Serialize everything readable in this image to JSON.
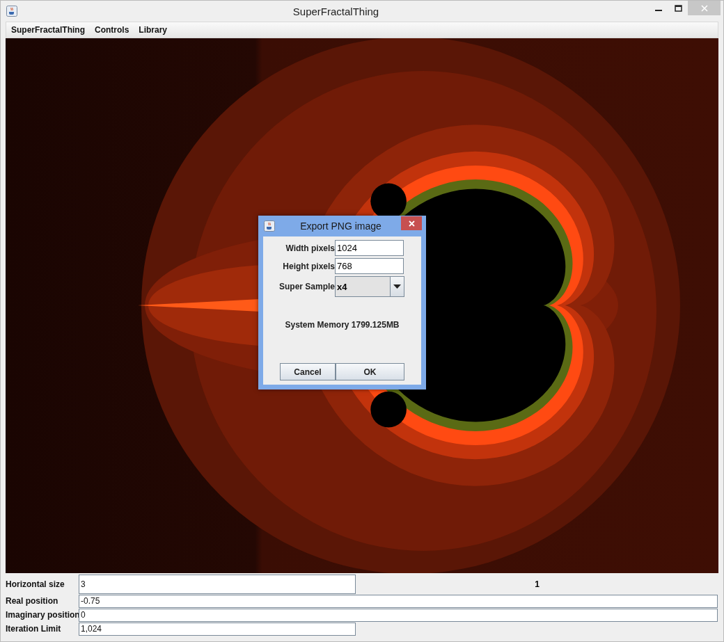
{
  "window": {
    "title": "SuperFractalThing"
  },
  "menu": [
    "SuperFractalThing",
    "Controls",
    "Library"
  ],
  "dialog": {
    "title": "Export PNG image",
    "fields": [
      {
        "label": "Width pixels",
        "value": "1024",
        "kind": "text"
      },
      {
        "label": "Height pixels",
        "value": "768",
        "kind": "text"
      },
      {
        "label": "Super Sample",
        "value": "x4",
        "kind": "dropdown"
      }
    ],
    "memory": "System Memory 1799.125MB",
    "buttons": [
      "Cancel",
      "OK"
    ]
  },
  "controls": [
    {
      "label": "Horizontal size",
      "value": "3",
      "kind": "short",
      "note": "1"
    },
    {
      "label": "Real position",
      "value": "-0.75",
      "kind": "wide"
    },
    {
      "label": "Imaginary position",
      "value": "0",
      "kind": "wide"
    },
    {
      "label": "Iteration Limit",
      "value": "1,024",
      "kind": "short"
    }
  ]
}
